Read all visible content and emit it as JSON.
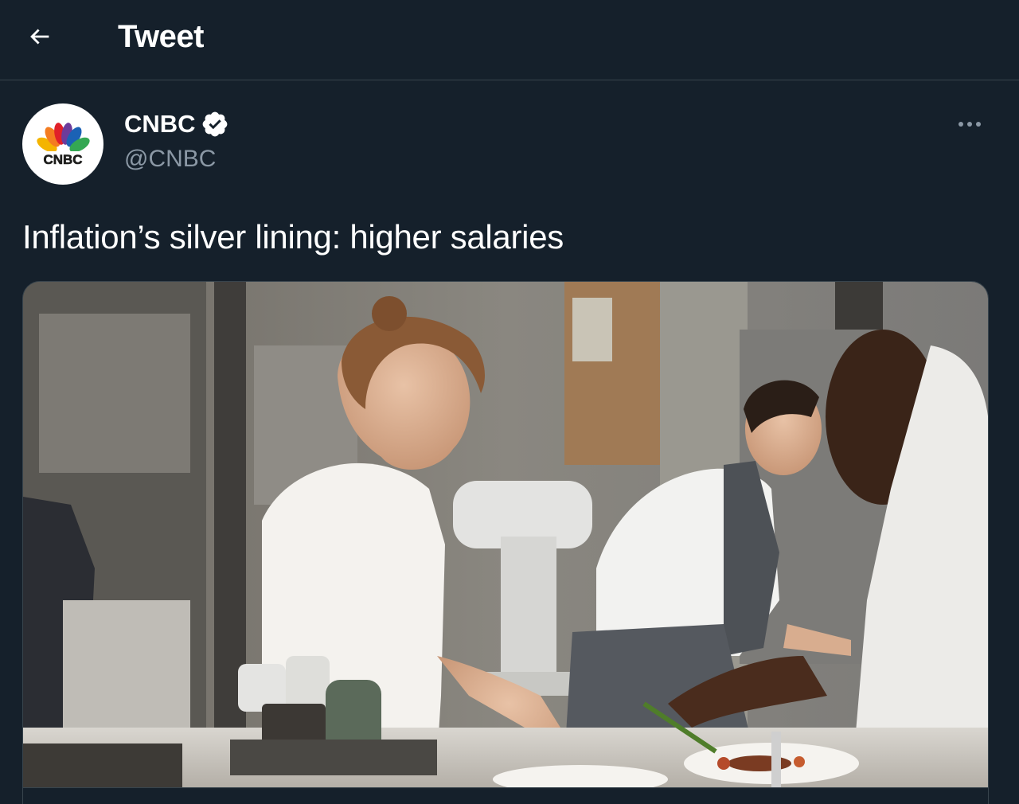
{
  "header": {
    "title": "Tweet",
    "back_icon": "arrow-left-icon"
  },
  "tweet": {
    "author": {
      "display_name": "CNBC",
      "handle": "@CNBC",
      "verified": true,
      "avatar_logo_text": "CNBC"
    },
    "more_icon": "more-horizontal-icon",
    "text": "Inflation’s silver lining: higher salaries",
    "media": {
      "type": "photo",
      "subject": "chefs plating food in a restaurant kitchen"
    }
  },
  "colors": {
    "background": "#15202b",
    "border": "#38444d",
    "secondary_text": "#8b98a5",
    "primary_text": "#ffffff"
  }
}
